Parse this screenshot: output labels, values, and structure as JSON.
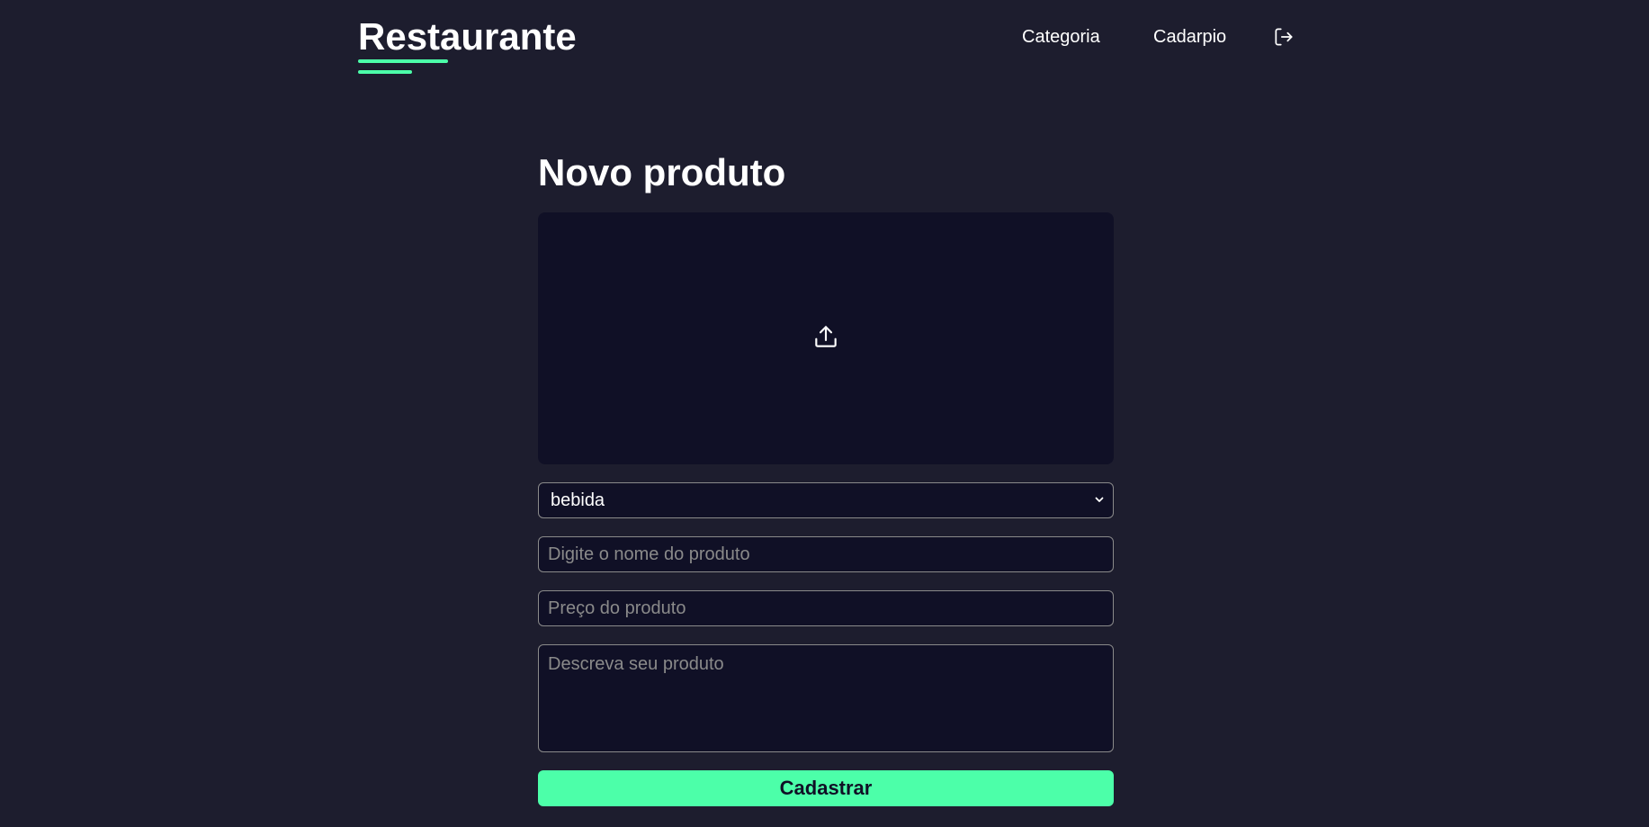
{
  "header": {
    "logo_text": "Restaurante",
    "nav": {
      "categoria_label": "Categoria",
      "cardapio_label": "Cadarpio"
    },
    "logout_icon": "logout-icon"
  },
  "main": {
    "title": "Novo produto",
    "upload_icon": "upload-icon",
    "category_select": {
      "selected": "bebida"
    },
    "name_input": {
      "value": "",
      "placeholder": "Digite o nome do produto"
    },
    "price_input": {
      "value": "",
      "placeholder": "Preço do produto"
    },
    "description_input": {
      "value": "",
      "placeholder": "Descreva seu produto"
    },
    "submit_label": "Cadastrar"
  },
  "colors": {
    "background": "#1d1d2e",
    "surface": "#101026",
    "accent": "#4cffa9",
    "border": "#8a8a8a",
    "text": "#ffffff"
  }
}
